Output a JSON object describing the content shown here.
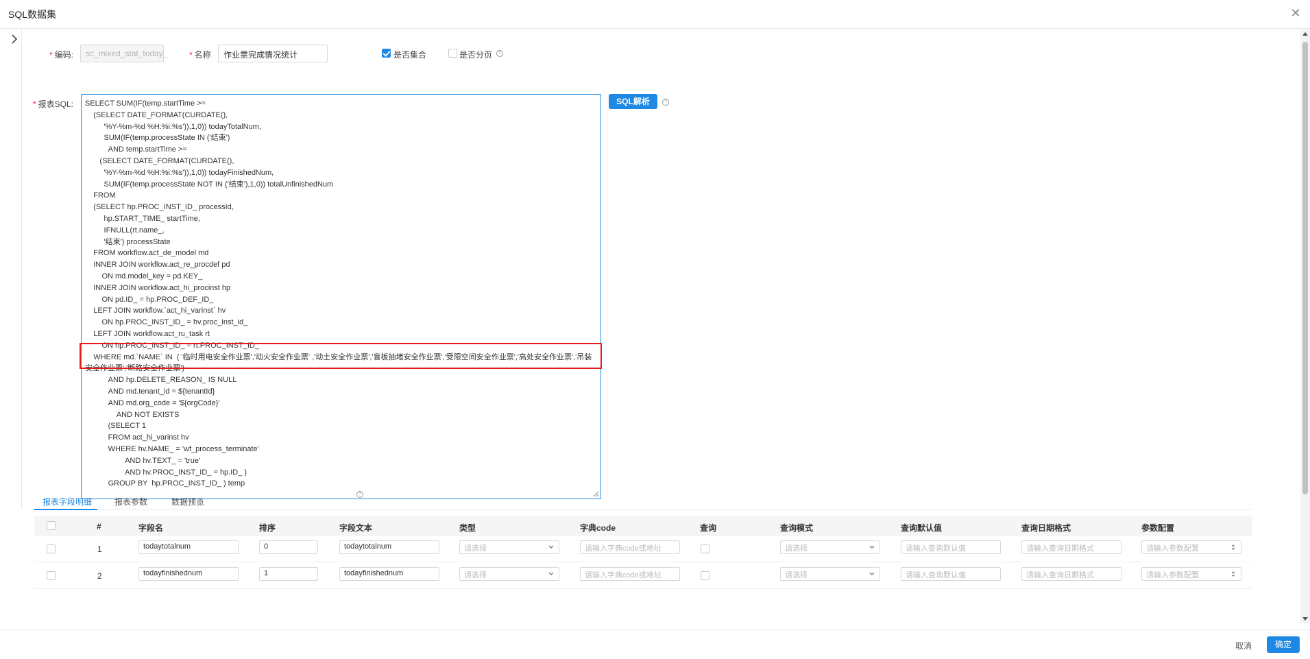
{
  "modal": {
    "title": "SQL数据集"
  },
  "form": {
    "code_label": "编码:",
    "code_value": "sc_mixed_stat_today_",
    "name_label": "名称",
    "name_value": "作业票完成情况统计",
    "is_collection_label": "是否集合",
    "is_collection_checked": true,
    "is_paged_label": "是否分页",
    "is_paged_checked": false,
    "sql_label": "报表SQL:",
    "sql_parse_button": "SQL解析",
    "sql_text": "SELECT SUM(IF(temp.startTime >=\n    (SELECT DATE_FORMAT(CURDATE(),\n         '%Y-%m-%d %H:%i:%s')),1,0)) todayTotalNum,\n         SUM(IF(temp.processState IN ('结束')\n           AND temp.startTime >=\n       (SELECT DATE_FORMAT(CURDATE(),\n         '%Y-%m-%d %H:%i:%s')),1,0)) todayFinishedNum,\n         SUM(IF(temp.processState NOT IN ('结束'),1,0)) totalUnfinishedNum\n    FROM\n    (SELECT hp.PROC_INST_ID_ processId,\n         hp.START_TIME_ startTime,\n         IFNULL(rt.name_,\n         '结束') processState\n    FROM workflow.act_de_model md\n    INNER JOIN workflow.act_re_procdef pd\n        ON md.model_key = pd.KEY_\n    INNER JOIN workflow.act_hi_procinst hp\n        ON pd.ID_ = hp.PROC_DEF_ID_\n    LEFT JOIN workflow.`act_hi_varinst` hv\n        ON hp.PROC_INST_ID_ = hv.proc_inst_id_\n    LEFT JOIN workflow.act_ru_task rt\n        ON hp.PROC_INST_ID_ = rt.PROC_INST_ID_\n    WHERE md.`NAME` IN  ( '临时用电安全作业票','动火安全作业票' ,'动土安全作业票','盲板抽堵安全作业票','受限空间安全作业票','高处安全作业票','吊装安全作业票','断路安全作业票')\n           AND hp.DELETE_REASON_ IS NULL\n           AND md.tenant_id = ${tenantId}\n           AND md.org_code = '${orgCode}'\n               AND NOT EXISTS\n           (SELECT 1\n           FROM act_hi_varinst hv\n           WHERE hv.NAME_ = 'wf_process_terminate'\n                   AND hv.TEXT_ = 'true'\n                   AND hv.PROC_INST_ID_ = hp.ID_ )\n           GROUP BY  hp.PROC_INST_ID_ ) temp"
  },
  "tabs": [
    {
      "label": "报表字段明细",
      "active": true
    },
    {
      "label": "报表参数",
      "active": false
    },
    {
      "label": "数据预览",
      "active": false
    }
  ],
  "table": {
    "headers": [
      "#",
      "字段名",
      "排序",
      "字段文本",
      "类型",
      "字典code",
      "查询",
      "查询模式",
      "查询默认值",
      "查询日期格式",
      "参数配置"
    ],
    "rows": [
      {
        "index": "1",
        "field_name": "todaytotalnum",
        "order": "0",
        "field_text": "todaytotalnum",
        "type_placeholder": "请选择",
        "dict_placeholder": "请输入字典code或地址",
        "query_mode_placeholder": "请选择",
        "default_placeholder": "请输入查询默认值",
        "date_format_placeholder": "请输入查询日期格式",
        "param_placeholder": "请输入参数配置"
      },
      {
        "index": "2",
        "field_name": "todayfinishednum",
        "order": "1",
        "field_text": "todayfinishednum",
        "type_placeholder": "请选择",
        "dict_placeholder": "请输入字典code或地址",
        "query_mode_placeholder": "请选择",
        "default_placeholder": "请输入查询默认值",
        "date_format_placeholder": "请输入查询日期格式",
        "param_placeholder": "请输入参数配置"
      }
    ]
  },
  "footer": {
    "cancel_label": "取消",
    "ok_label": "确定"
  },
  "colors": {
    "accent": "#1e88e5",
    "highlight_box": "#e01e1e"
  },
  "icons": {
    "close": "close-icon",
    "expand": "chevron-right-icon",
    "help": "question-circle-icon",
    "dropdown": "chevron-down-icon"
  }
}
